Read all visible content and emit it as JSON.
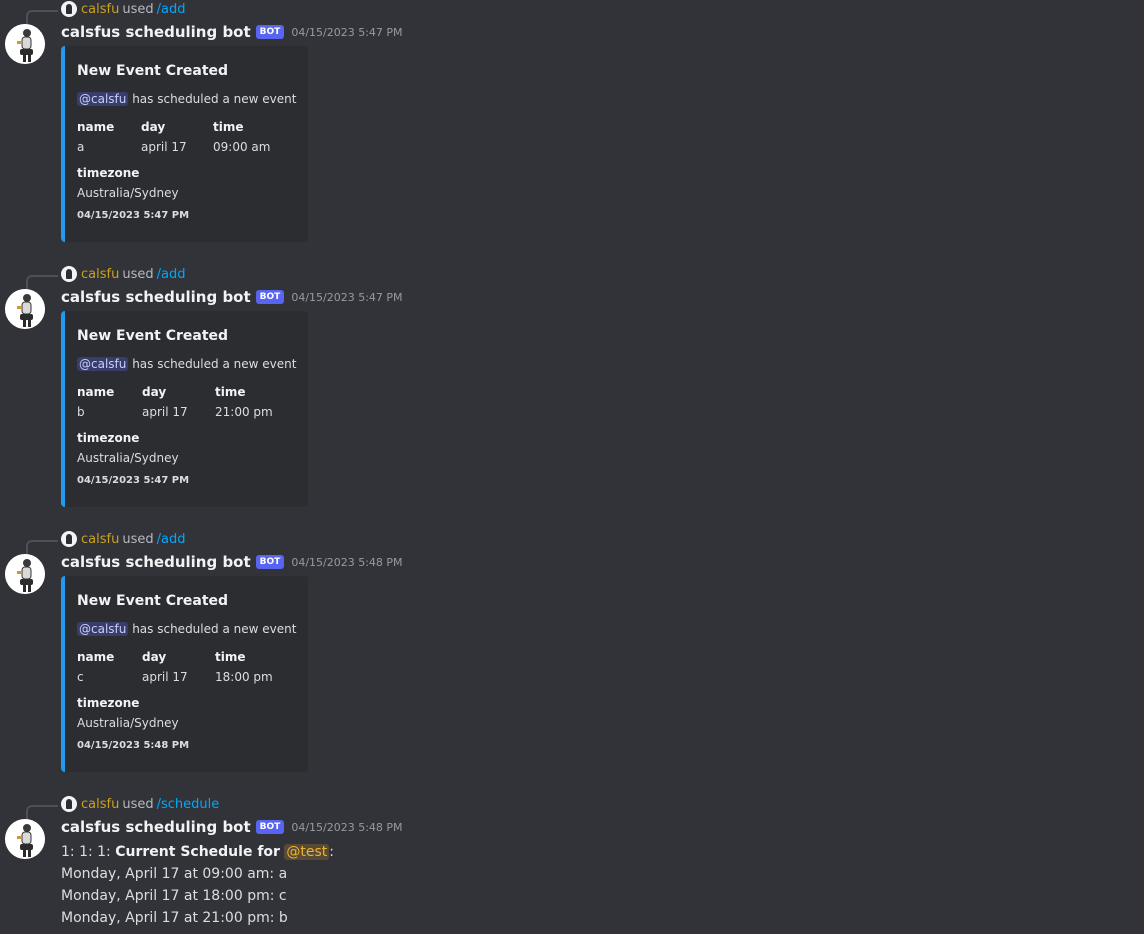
{
  "messages": [
    {
      "reply": {
        "user": "calsfu",
        "used": "used",
        "command": "/add"
      },
      "bot": {
        "name": "calsfus scheduling bot",
        "tag": "BOT",
        "timestamp": "04/15/2023 5:47 PM"
      },
      "embed": {
        "title": "New Event Created",
        "mention": "@calsfu",
        "desc": "has scheduled a new event",
        "fields": [
          {
            "name": "name",
            "value": "a"
          },
          {
            "name": "day",
            "value": "april 17"
          },
          {
            "name": "time",
            "value": "09:00 am"
          },
          {
            "name": "timezone",
            "value": "Australia/Sydney"
          }
        ],
        "footer": "04/15/2023 5:47 PM"
      }
    },
    {
      "reply": {
        "user": "calsfu",
        "used": "used",
        "command": "/add"
      },
      "bot": {
        "name": "calsfus scheduling bot",
        "tag": "BOT",
        "timestamp": "04/15/2023 5:47 PM"
      },
      "embed": {
        "title": "New Event Created",
        "mention": "@calsfu",
        "desc": "has scheduled a new event",
        "fields": [
          {
            "name": "name",
            "value": "b"
          },
          {
            "name": "day",
            "value": "april 17"
          },
          {
            "name": "time",
            "value": "21:00 pm"
          },
          {
            "name": "timezone",
            "value": "Australia/Sydney"
          }
        ],
        "footer": "04/15/2023 5:47 PM"
      }
    },
    {
      "reply": {
        "user": "calsfu",
        "used": "used",
        "command": "/add"
      },
      "bot": {
        "name": "calsfus scheduling bot",
        "tag": "BOT",
        "timestamp": "04/15/2023 5:48 PM"
      },
      "embed": {
        "title": "New Event Created",
        "mention": "@calsfu",
        "desc": "has scheduled a new event",
        "fields": [
          {
            "name": "name",
            "value": "c"
          },
          {
            "name": "day",
            "value": "april 17"
          },
          {
            "name": "time",
            "value": "18:00 pm"
          },
          {
            "name": "timezone",
            "value": "Australia/Sydney"
          }
        ],
        "footer": "04/15/2023 5:48 PM"
      }
    },
    {
      "reply": {
        "user": "calsfu",
        "used": "used",
        "command": "/schedule"
      },
      "bot": {
        "name": "calsfus scheduling bot",
        "tag": "BOT",
        "timestamp": "04/15/2023 5:48 PM"
      },
      "content": {
        "prefix": "1: 1: 1:",
        "heading": "Current Schedule for",
        "mention": "@test",
        "suffix": ":",
        "lines": [
          "Monday, April 17 at 09:00 am: a",
          "Monday, April 17 at 18:00 pm: c",
          "Monday, April 17 at 21:00 pm: b"
        ]
      }
    }
  ],
  "colors": {
    "background": "#313338",
    "embed_bg": "#2b2d31",
    "embed_border": "#1f9bf0",
    "bot_tag": "#5865f2",
    "reply_user": "#c9a21b",
    "command_link": "#00a8fc"
  }
}
